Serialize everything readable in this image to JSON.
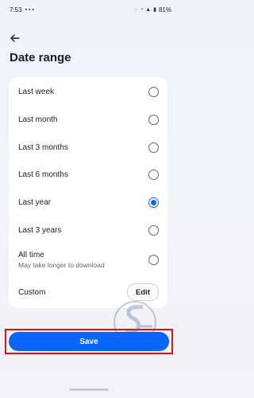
{
  "status_bar": {
    "time": "7:53",
    "battery": "81%"
  },
  "header": {
    "title": "Date range"
  },
  "options": [
    {
      "label": "Last week",
      "selected": false
    },
    {
      "label": "Last month",
      "selected": false
    },
    {
      "label": "Last 3 months",
      "selected": false
    },
    {
      "label": "Last 6 months",
      "selected": false
    },
    {
      "label": "Last year",
      "selected": true
    },
    {
      "label": "Last 3 years",
      "selected": false
    },
    {
      "label": "All time",
      "sublabel": "May take longer to download",
      "selected": false
    }
  ],
  "custom": {
    "label": "Custom",
    "edit_label": "Edit"
  },
  "save_label": "Save",
  "colors": {
    "accent": "#0866ff",
    "highlight": "#e0101a",
    "card": "#ffffff"
  }
}
